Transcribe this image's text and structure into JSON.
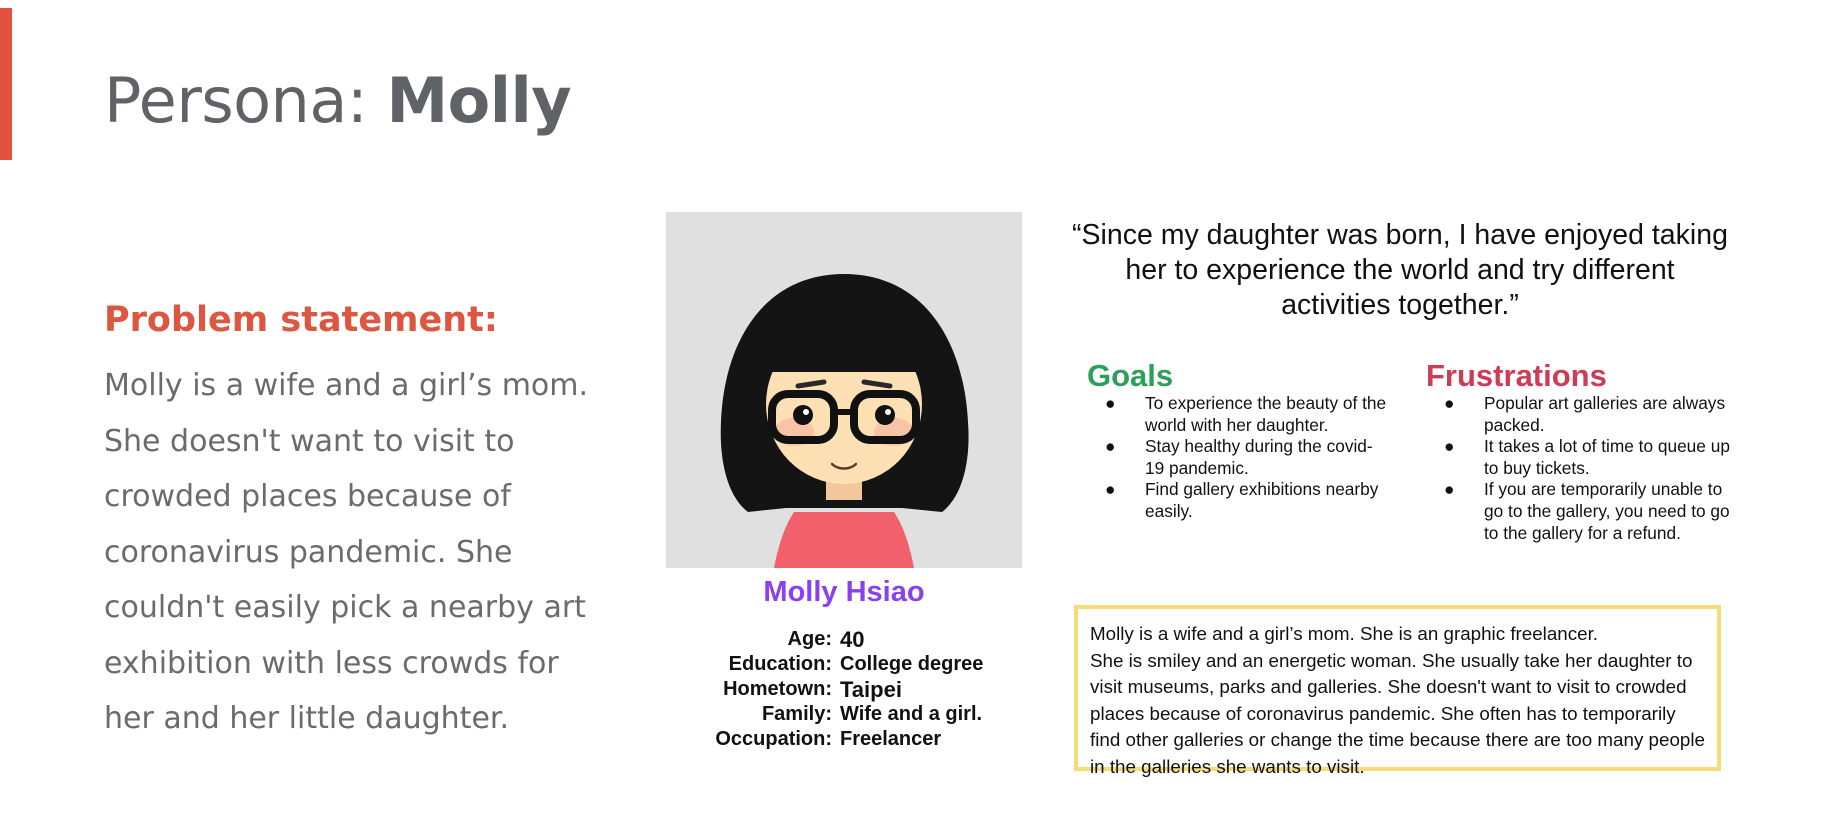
{
  "header": {
    "title_prefix": "Persona: ",
    "title_name": "Molly",
    "accent_color": "#e2533d"
  },
  "problem": {
    "heading": "Problem statement:",
    "text": "Molly is a wife and a girl’s mom. She doesn't want to visit to crowded places because of coronavirus pandemic. She couldn't easily pick a nearby art exhibition with less crowds for her and her little daughter."
  },
  "persona": {
    "avatar_icon": "girl-with-glasses-avatar",
    "name": "Molly Hsiao",
    "details": [
      {
        "label": "Age:",
        "value": "40"
      },
      {
        "label": "Education:",
        "value": "College degree"
      },
      {
        "label": "Hometown:",
        "value": "Taipei"
      },
      {
        "label": "Family:",
        "value": "Wife and a girl."
      },
      {
        "label": "Occupation:",
        "value": "Freelancer"
      }
    ]
  },
  "quote": "“Since my daughter was born, I have enjoyed taking her to experience the world and try different activities together.”",
  "goals": {
    "heading": "Goals",
    "items": [
      "To experience the beauty of the world with her daughter.",
      "Stay healthy during the covid-19 pandemic.",
      "Find  gallery exhibitions nearby easily."
    ]
  },
  "frustrations": {
    "heading": "Frustrations",
    "items": [
      "Popular art galleries are always packed.",
      "It takes a lot of time to queue up to buy tickets.",
      "If you are temporarily unable to go to the gallery, you need to go to the gallery for a refund."
    ]
  },
  "bio": {
    "lines": [
      "Molly is a wife and a girl’s mom. She is an graphic freelancer.",
      "She is smiley and an energetic woman. She usually take her daughter to visit museums, parks and galleries. She doesn't want to visit to crowded places because of coronavirus pandemic. She often has to temporarily find other galleries or change the time because there are too many people in the galleries she wants to visit."
    ]
  },
  "colors": {
    "problem_heading": "#dd5640",
    "name": "#8a3ff0",
    "goals": "#2e9e5b",
    "frustrations": "#cf3a55",
    "bio_border": "#f6dc76"
  }
}
